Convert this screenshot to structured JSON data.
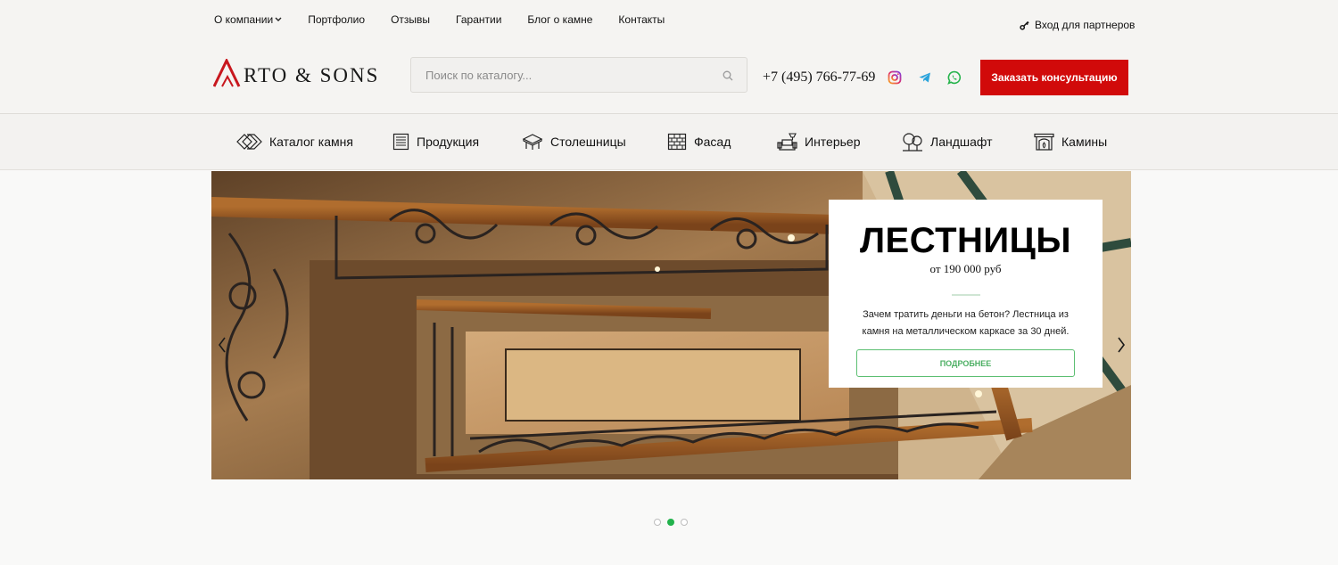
{
  "topnav": {
    "items": [
      {
        "label": "О компании",
        "dropdown": true
      },
      {
        "label": "Портфолио"
      },
      {
        "label": "Отзывы"
      },
      {
        "label": "Гарантии"
      },
      {
        "label": "Блог о камне"
      },
      {
        "label": "Контакты"
      }
    ],
    "partner_label": "Вход для партнеров"
  },
  "logo": {
    "text": "RTO & SONS",
    "mark_color": "#c8171e"
  },
  "search": {
    "placeholder": "Поиск по каталогу..."
  },
  "phone": "+7 (495) 766-77-69",
  "social": [
    "instagram-icon",
    "telegram-icon",
    "whatsapp-icon"
  ],
  "cta_label": "Заказать консультацию",
  "categories": [
    {
      "label": "Каталог камня",
      "icon": "stone-catalog-icon"
    },
    {
      "label": "Продукция",
      "icon": "products-icon"
    },
    {
      "label": "Столешницы",
      "icon": "countertop-icon"
    },
    {
      "label": "Фасад",
      "icon": "facade-icon"
    },
    {
      "label": "Интерьер",
      "icon": "interior-icon"
    },
    {
      "label": "Ландшафт",
      "icon": "landscape-icon"
    },
    {
      "label": "Камины",
      "icon": "fireplace-icon"
    }
  ],
  "slide": {
    "title": "ЛЕСТНИЦЫ",
    "price": "от 190 000 руб",
    "description": "Зачем тратить деньги на бетон? Лестница из камня на металлическом каркасе за 30 дней.",
    "button_label": "ПОДРОБНЕЕ"
  },
  "slider": {
    "total": 3,
    "active_index": 1
  },
  "colors": {
    "accent_red": "#d10a0a",
    "accent_green": "#22b24c"
  }
}
